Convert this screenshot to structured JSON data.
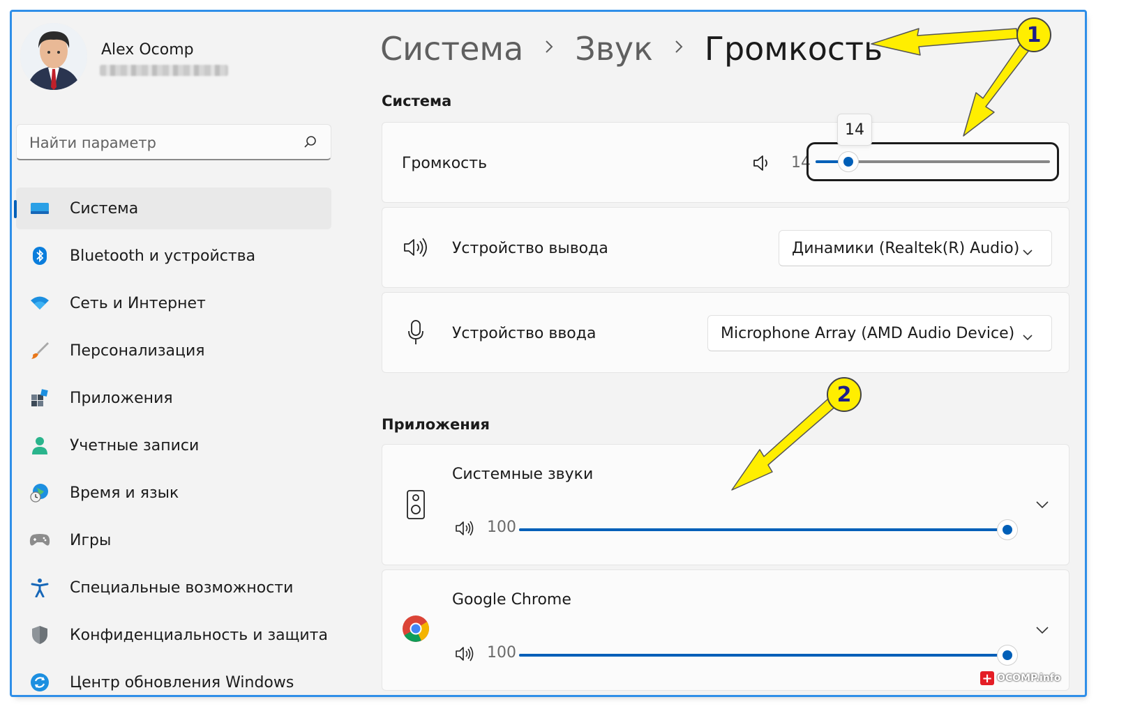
{
  "user": {
    "name": "Alex Ocomp"
  },
  "search": {
    "placeholder": "Найти параметр"
  },
  "nav": {
    "items": [
      {
        "label": "Система",
        "active": true
      },
      {
        "label": "Bluetooth и устройства"
      },
      {
        "label": "Сеть и Интернет"
      },
      {
        "label": "Персонализация"
      },
      {
        "label": "Приложения"
      },
      {
        "label": "Учетные записи"
      },
      {
        "label": "Время и язык"
      },
      {
        "label": "Игры"
      },
      {
        "label": "Специальные возможности"
      },
      {
        "label": "Конфиденциальность и защита"
      },
      {
        "label": "Центр обновления Windows"
      }
    ]
  },
  "breadcrumb": {
    "root": "Система",
    "middle": "Звук",
    "current": "Громкость"
  },
  "system_section": {
    "title": "Система",
    "volume": {
      "label": "Громкость",
      "value": "14",
      "tooltip": "14",
      "level_percent": 14
    },
    "output": {
      "label": "Устройство вывода",
      "selected": "Динамики (Realtek(R) Audio)"
    },
    "input": {
      "label": "Устройство ввода",
      "selected": "Microphone Array (AMD Audio Device)"
    }
  },
  "apps_section": {
    "title": "Приложения",
    "apps": [
      {
        "name": "Системные звуки",
        "volume": "100",
        "level_percent": 100
      },
      {
        "name": "Google Chrome",
        "volume": "100",
        "level_percent": 100
      }
    ]
  },
  "annotations": {
    "badge1": "1",
    "badge2": "2"
  },
  "watermark": {
    "text": "OCOMP.info",
    "cross": "+"
  },
  "colors": {
    "accent": "#005fb8",
    "frame": "#2f8fe8",
    "arrow": "#ffee00"
  }
}
